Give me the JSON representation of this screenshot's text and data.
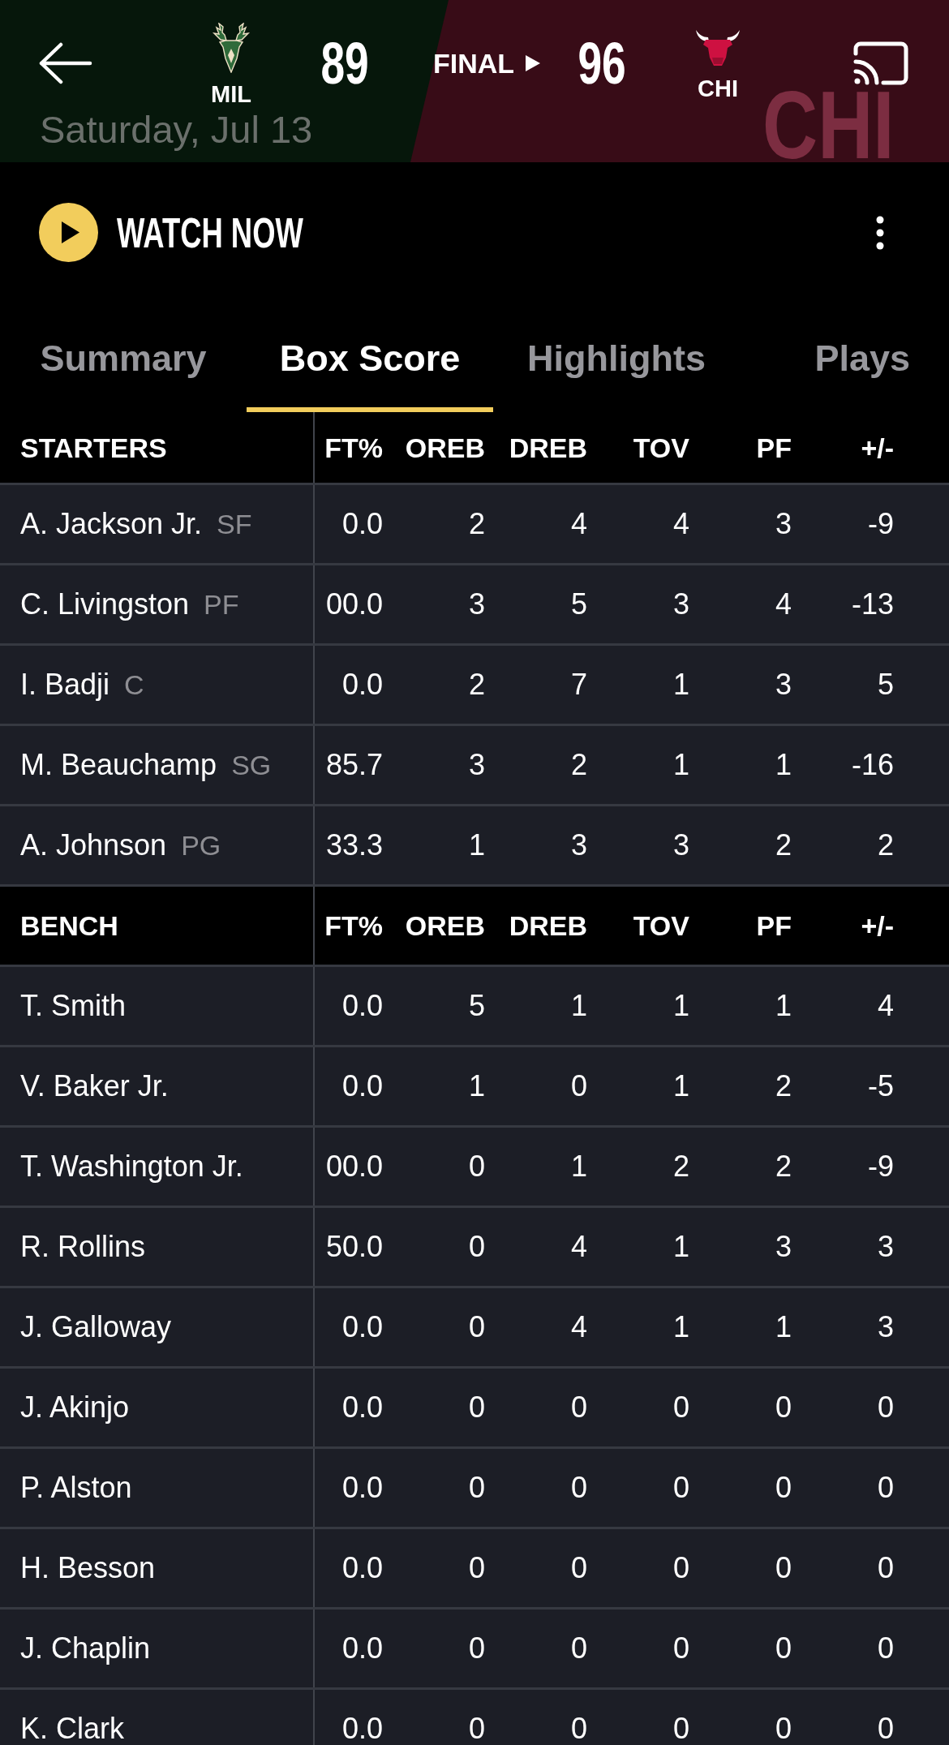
{
  "header": {
    "teams": [
      {
        "abbr": "MIL",
        "score": "89"
      },
      {
        "abbr": "CHI",
        "score": "96"
      }
    ],
    "status": "FINAL",
    "date": "Saturday, Jul 13",
    "backdrop_text": "CHI"
  },
  "watch": {
    "label": "WATCH NOW"
  },
  "tabs": [
    {
      "label": "Summary",
      "selected": false
    },
    {
      "label": "Box Score",
      "selected": true
    },
    {
      "label": "Highlights",
      "selected": false
    },
    {
      "label": "Plays",
      "selected": false
    }
  ],
  "box_score": {
    "sections": [
      {
        "title": "STARTERS",
        "columns": [
          "FT%",
          "OREB",
          "DREB",
          "TOV",
          "PF",
          "+/-"
        ],
        "rows": [
          {
            "player": {
              "name": "A. Jackson Jr.",
              "position": "SF"
            },
            "stats": [
              "0.0",
              "2",
              "4",
              "4",
              "3",
              "-9"
            ]
          },
          {
            "player": {
              "name": "C. Livingston",
              "position": "PF"
            },
            "stats": [
              "00.0",
              "3",
              "5",
              "3",
              "4",
              "-13"
            ]
          },
          {
            "player": {
              "name": "I. Badji",
              "position": "C"
            },
            "stats": [
              "0.0",
              "2",
              "7",
              "1",
              "3",
              "5"
            ]
          },
          {
            "player": {
              "name": "M. Beauchamp",
              "position": "SG"
            },
            "stats": [
              "85.7",
              "3",
              "2",
              "1",
              "1",
              "-16"
            ]
          },
          {
            "player": {
              "name": "A. Johnson",
              "position": "PG"
            },
            "stats": [
              "33.3",
              "1",
              "3",
              "3",
              "2",
              "2"
            ]
          }
        ]
      },
      {
        "title": "BENCH",
        "columns": [
          "FT%",
          "OREB",
          "DREB",
          "TOV",
          "PF",
          "+/-"
        ],
        "rows": [
          {
            "player": {
              "name": "T. Smith"
            },
            "stats": [
              "0.0",
              "5",
              "1",
              "1",
              "1",
              "4"
            ]
          },
          {
            "player": {
              "name": "V. Baker Jr."
            },
            "stats": [
              "0.0",
              "1",
              "0",
              "1",
              "2",
              "-5"
            ]
          },
          {
            "player": {
              "name": "T. Washington Jr."
            },
            "stats": [
              "00.0",
              "0",
              "1",
              "2",
              "2",
              "-9"
            ]
          },
          {
            "player": {
              "name": "R. Rollins"
            },
            "stats": [
              "50.0",
              "0",
              "4",
              "1",
              "3",
              "3"
            ]
          },
          {
            "player": {
              "name": "J. Galloway"
            },
            "stats": [
              "0.0",
              "0",
              "4",
              "1",
              "1",
              "3"
            ]
          },
          {
            "player": {
              "name": "J. Akinjo"
            },
            "stats": [
              "0.0",
              "0",
              "0",
              "0",
              "0",
              "0"
            ]
          },
          {
            "player": {
              "name": "P. Alston"
            },
            "stats": [
              "0.0",
              "0",
              "0",
              "0",
              "0",
              "0"
            ]
          },
          {
            "player": {
              "name": "H. Besson"
            },
            "stats": [
              "0.0",
              "0",
              "0",
              "0",
              "0",
              "0"
            ]
          },
          {
            "player": {
              "name": "J. Chaplin"
            },
            "stats": [
              "0.0",
              "0",
              "0",
              "0",
              "0",
              "0"
            ]
          },
          {
            "player": {
              "name": "K. Clark"
            },
            "stats": [
              "0.0",
              "0",
              "0",
              "0",
              "0",
              "0"
            ]
          }
        ]
      }
    ]
  }
}
